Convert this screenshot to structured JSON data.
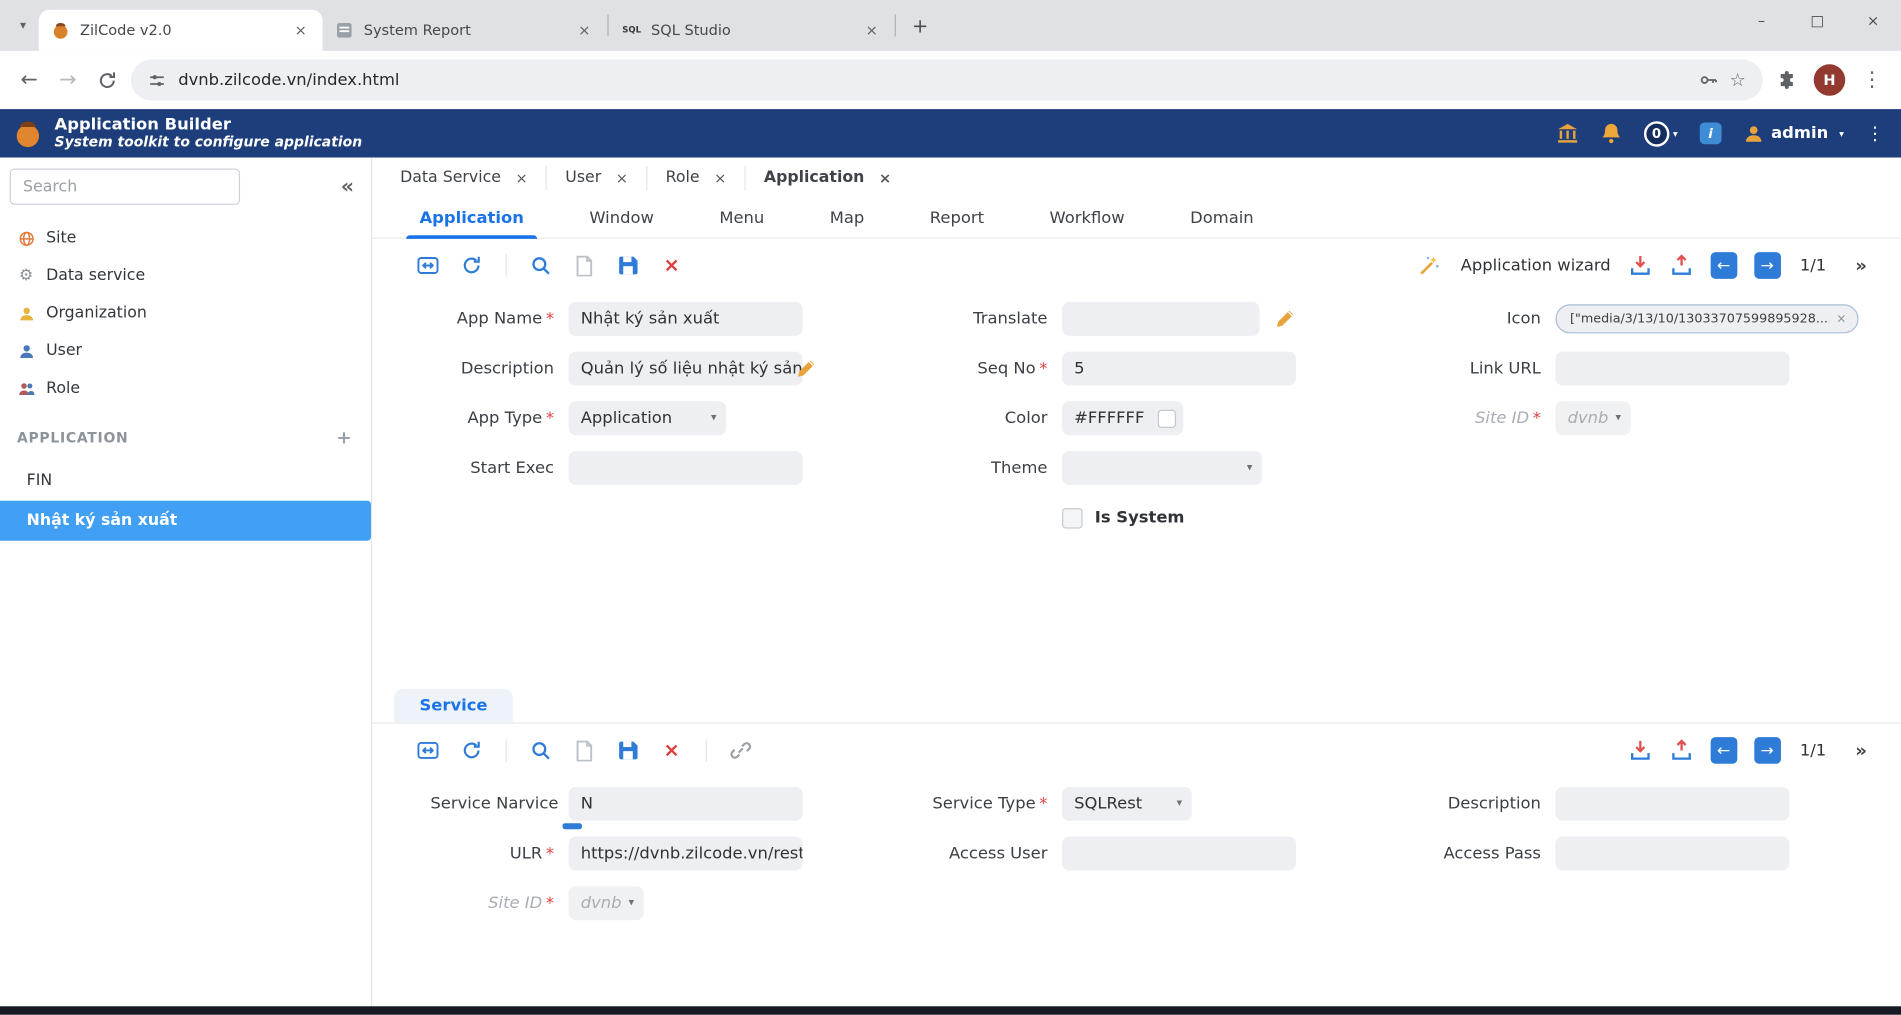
{
  "browser": {
    "tabs": [
      {
        "title": "ZilCode v2.0"
      },
      {
        "title": "System Report"
      },
      {
        "title": "SQL Studio",
        "favicon_text": "SQL"
      }
    ],
    "url": "dvnb.zilcode.vn/index.html",
    "profile_initial": "H"
  },
  "header": {
    "title": "Application Builder",
    "subtitle": "System toolkit to configure application",
    "badge_count": "0",
    "info_glyph": "i",
    "user_label": "admin"
  },
  "sidebar": {
    "search_placeholder": "Search",
    "items": [
      {
        "label": "Site"
      },
      {
        "label": "Data service"
      },
      {
        "label": "Organization"
      },
      {
        "label": "User"
      },
      {
        "label": "Role"
      }
    ],
    "section_title": "APPLICATION",
    "apps": [
      {
        "label": "FIN"
      },
      {
        "label": "Nhật ký sản xuất"
      }
    ]
  },
  "workspace": {
    "open_docs": [
      {
        "label": "Data Service"
      },
      {
        "label": "User"
      },
      {
        "label": "Role"
      },
      {
        "label": "Application"
      }
    ],
    "module_tabs": [
      {
        "label": "Application"
      },
      {
        "label": "Window"
      },
      {
        "label": "Menu"
      },
      {
        "label": "Map"
      },
      {
        "label": "Report"
      },
      {
        "label": "Workflow"
      },
      {
        "label": "Domain"
      }
    ]
  },
  "app_toolbar": {
    "wizard_label": "Application wizard",
    "pager": "1/1"
  },
  "app_form": {
    "app_name": {
      "label": "App Name",
      "value": "Nhật ký sản xuất"
    },
    "description": {
      "label": "Description",
      "value": "Quản lý số liệu nhật ký sản xuất"
    },
    "app_type": {
      "label": "App Type",
      "value": "Application"
    },
    "start_exec": {
      "label": "Start Exec",
      "value": ""
    },
    "translate": {
      "label": "Translate",
      "value": ""
    },
    "seq_no": {
      "label": "Seq No",
      "value": "5"
    },
    "color": {
      "label": "Color",
      "value": "#FFFFFF"
    },
    "theme": {
      "label": "Theme",
      "value": ""
    },
    "is_system": {
      "label": "Is System",
      "checked": false
    },
    "icon": {
      "label": "Icon",
      "value": "[\"media/3/13/10/13033707599895928...."
    },
    "link_url": {
      "label": "Link URL",
      "value": ""
    },
    "site_id": {
      "label": "Site ID",
      "value": "dvnb"
    }
  },
  "service_panel": {
    "tab_label": "Service",
    "pager": "1/1",
    "service_name": {
      "label": "Service Narvice",
      "value": "N"
    },
    "service_type": {
      "label": "Service Type",
      "value": "SQLRest"
    },
    "description": {
      "label": "Description",
      "value": ""
    },
    "ulr": {
      "label": "ULR",
      "value": "https://dvnb.zilcode.vn/rest/c"
    },
    "access_user": {
      "label": "Access User",
      "value": ""
    },
    "access_pass": {
      "label": "Access Pass",
      "value": ""
    },
    "site_id": {
      "label": "Site ID",
      "value": "dvnb"
    }
  },
  "theme_colors": {
    "header_bg": "#1d3d7b",
    "accent_blue": "#2e7cd8",
    "active_item_bg": "#41a0f4",
    "required_red": "#e04040",
    "white": "#FFFFFF"
  },
  "icon_glyphs": {
    "tab_search": "▾",
    "minimize": "–",
    "maximize": "□",
    "close": "×",
    "back": "←",
    "forward": "→",
    "new_tab": "+",
    "bookmark_star": "☆",
    "kebab": "⋮",
    "collapse": "«",
    "add": "+",
    "caret": "▾",
    "prev": "←",
    "next": "→",
    "more": "»",
    "delete_x": "×"
  }
}
